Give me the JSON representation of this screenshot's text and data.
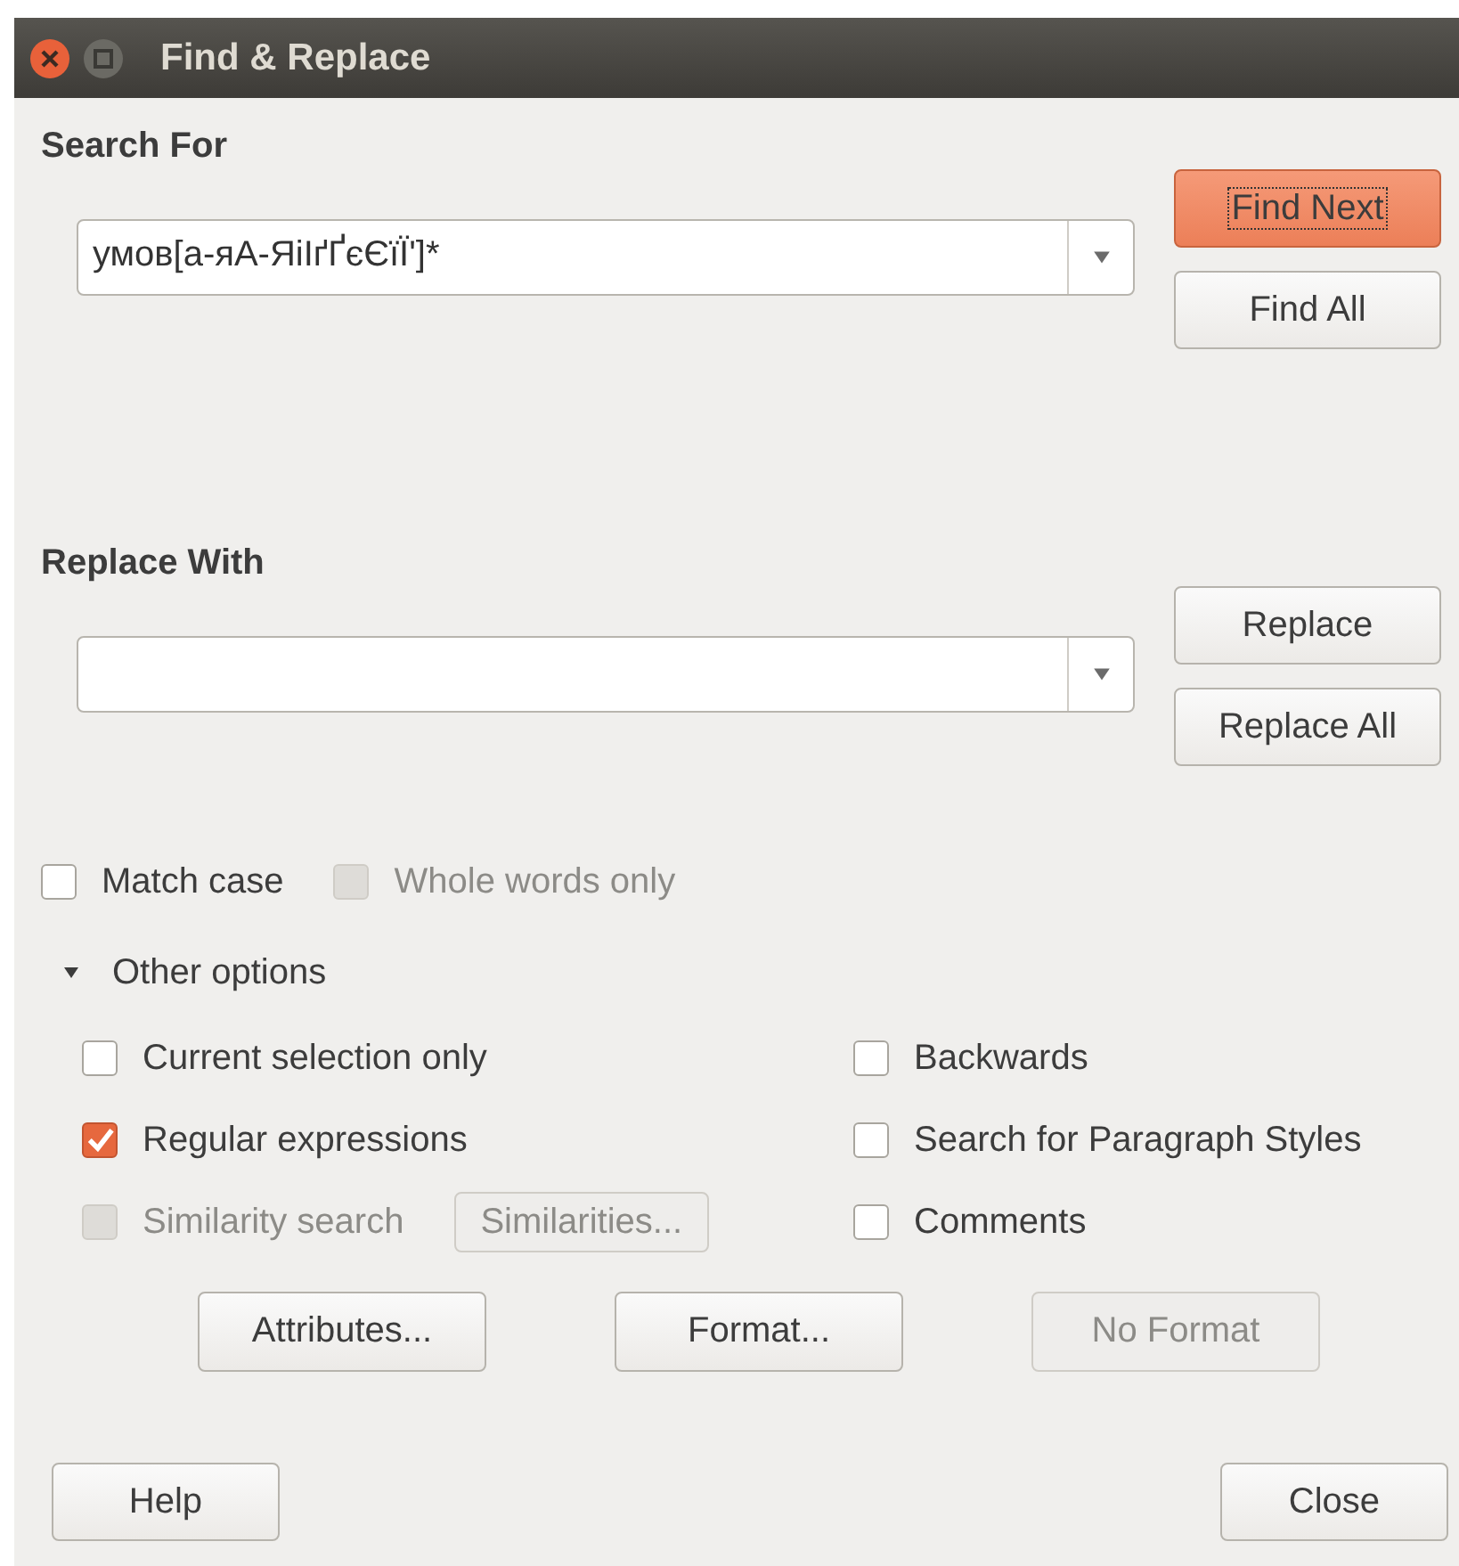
{
  "window": {
    "title": "Find & Replace"
  },
  "search": {
    "label": "Search For",
    "value": "умов[а-яА-ЯіІґҐєЄїЇ']*",
    "buttons": [
      {
        "label": "Find Next",
        "default": true,
        "focused": true
      },
      {
        "label": "Find All",
        "default": false,
        "focused": false
      }
    ]
  },
  "replace": {
    "label": "Replace With",
    "buttons": [
      {
        "label": "Replace",
        "default": false,
        "focused": false
      },
      {
        "label": "Replace All",
        "default": false,
        "focused": false
      }
    ]
  },
  "options": [
    {
      "label": "Match case",
      "checked": false,
      "disabled": false
    },
    {
      "label": "Whole words only",
      "checked": false,
      "disabled": true
    }
  ],
  "other_options": {
    "label": "Other options",
    "expanded": true,
    "left": [
      {
        "label": "Current selection only",
        "checked": false,
        "disabled": false
      },
      {
        "label": "Regular expressions",
        "checked": true,
        "disabled": false
      },
      {
        "label": "Similarity search",
        "checked": false,
        "disabled": true,
        "button": {
          "label": "Similarities...",
          "disabled": true
        }
      }
    ],
    "right": [
      {
        "label": "Backwards",
        "checked": false,
        "disabled": false
      },
      {
        "label": "Search for Paragraph Styles",
        "checked": false,
        "disabled": false
      },
      {
        "label": "Comments",
        "checked": false,
        "disabled": false
      }
    ],
    "buttons": [
      {
        "label": "Attributes...",
        "disabled": false
      },
      {
        "label": "Format...",
        "disabled": false
      },
      {
        "label": "No Format",
        "disabled": true
      }
    ]
  },
  "footer": [
    {
      "label": "Help"
    },
    {
      "label": "Close"
    }
  ]
}
